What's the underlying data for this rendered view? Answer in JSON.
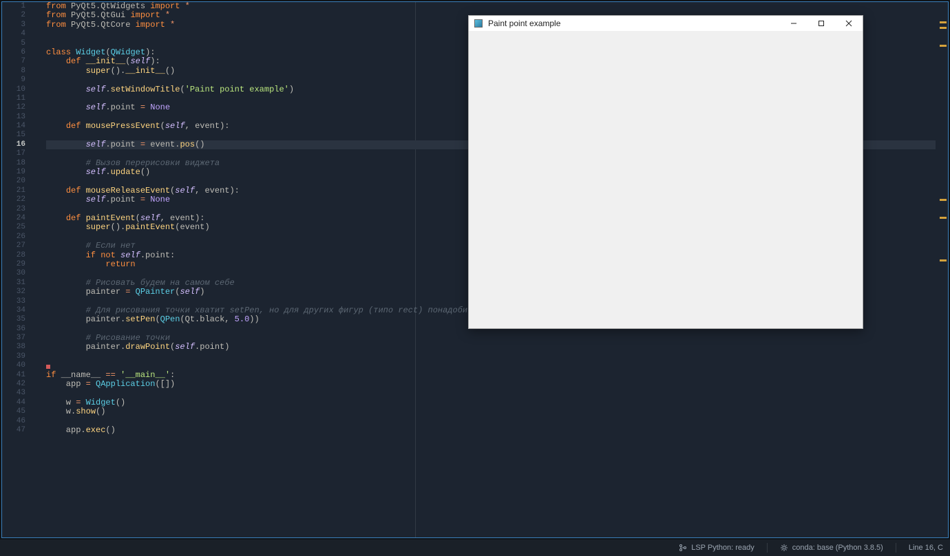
{
  "editor": {
    "currentLine": 16,
    "warnings": [
      1,
      2,
      3,
      6,
      32,
      35,
      42
    ],
    "lines": [
      {
        "n": 1,
        "tokens": [
          [
            "kw",
            "from"
          ],
          [
            "name",
            " PyQt5.QtWidgets "
          ],
          [
            "kw",
            "import"
          ],
          [
            "op",
            " *"
          ]
        ]
      },
      {
        "n": 2,
        "tokens": [
          [
            "kw",
            "from"
          ],
          [
            "name",
            " PyQt5.QtGui "
          ],
          [
            "kw",
            "import"
          ],
          [
            "op",
            " *"
          ]
        ]
      },
      {
        "n": 3,
        "tokens": [
          [
            "kw",
            "from"
          ],
          [
            "name",
            " PyQt5.QtCore "
          ],
          [
            "kw",
            "import"
          ],
          [
            "op",
            " *"
          ]
        ]
      },
      {
        "n": 4,
        "tokens": []
      },
      {
        "n": 5,
        "tokens": []
      },
      {
        "n": 6,
        "tokens": [
          [
            "kw",
            "class"
          ],
          [
            "name",
            " "
          ],
          [
            "cls",
            "Widget"
          ],
          [
            "punct",
            "("
          ],
          [
            "cls",
            "QWidget"
          ],
          [
            "punct",
            "):"
          ]
        ]
      },
      {
        "n": 7,
        "tokens": [
          [
            "name",
            "    "
          ],
          [
            "kw",
            "def"
          ],
          [
            "name",
            " "
          ],
          [
            "fn",
            "__init__"
          ],
          [
            "punct",
            "("
          ],
          [
            "self",
            "self"
          ],
          [
            "punct",
            "):"
          ]
        ]
      },
      {
        "n": 8,
        "tokens": [
          [
            "name",
            "        "
          ],
          [
            "fn",
            "super"
          ],
          [
            "punct",
            "()."
          ],
          [
            "fn",
            "__init__"
          ],
          [
            "punct",
            "()"
          ]
        ]
      },
      {
        "n": 9,
        "tokens": []
      },
      {
        "n": 10,
        "tokens": [
          [
            "name",
            "        "
          ],
          [
            "self",
            "self"
          ],
          [
            "punct",
            "."
          ],
          [
            "fn",
            "setWindowTitle"
          ],
          [
            "punct",
            "("
          ],
          [
            "str",
            "'Paint point example'"
          ],
          [
            "punct",
            ")"
          ]
        ]
      },
      {
        "n": 11,
        "tokens": []
      },
      {
        "n": 12,
        "tokens": [
          [
            "name",
            "        "
          ],
          [
            "self",
            "self"
          ],
          [
            "punct",
            ".point "
          ],
          [
            "op",
            "="
          ],
          [
            "name",
            " "
          ],
          [
            "none",
            "None"
          ]
        ]
      },
      {
        "n": 13,
        "tokens": []
      },
      {
        "n": 14,
        "tokens": [
          [
            "name",
            "    "
          ],
          [
            "kw",
            "def"
          ],
          [
            "name",
            " "
          ],
          [
            "fn",
            "mousePressEvent"
          ],
          [
            "punct",
            "("
          ],
          [
            "self",
            "self"
          ],
          [
            "punct",
            ", event):"
          ]
        ]
      },
      {
        "n": 15,
        "tokens": []
      },
      {
        "n": 16,
        "tokens": [
          [
            "name",
            "        "
          ],
          [
            "self",
            "self"
          ],
          [
            "punct",
            ".point "
          ],
          [
            "op",
            "="
          ],
          [
            "name",
            " event."
          ],
          [
            "fn",
            "pos"
          ],
          [
            "punct",
            "()"
          ]
        ]
      },
      {
        "n": 17,
        "tokens": []
      },
      {
        "n": 18,
        "tokens": [
          [
            "name",
            "        "
          ],
          [
            "cmt",
            "# Вызов перерисовки виджета"
          ]
        ]
      },
      {
        "n": 19,
        "tokens": [
          [
            "name",
            "        "
          ],
          [
            "self",
            "self"
          ],
          [
            "punct",
            "."
          ],
          [
            "fn",
            "update"
          ],
          [
            "punct",
            "()"
          ]
        ]
      },
      {
        "n": 20,
        "tokens": []
      },
      {
        "n": 21,
        "tokens": [
          [
            "name",
            "    "
          ],
          [
            "kw",
            "def"
          ],
          [
            "name",
            " "
          ],
          [
            "fn",
            "mouseReleaseEvent"
          ],
          [
            "punct",
            "("
          ],
          [
            "self",
            "self"
          ],
          [
            "punct",
            ", event):"
          ]
        ]
      },
      {
        "n": 22,
        "tokens": [
          [
            "name",
            "        "
          ],
          [
            "self",
            "self"
          ],
          [
            "punct",
            ".point "
          ],
          [
            "op",
            "="
          ],
          [
            "name",
            " "
          ],
          [
            "none",
            "None"
          ]
        ]
      },
      {
        "n": 23,
        "tokens": []
      },
      {
        "n": 24,
        "tokens": [
          [
            "name",
            "    "
          ],
          [
            "kw",
            "def"
          ],
          [
            "name",
            " "
          ],
          [
            "fn",
            "paintEvent"
          ],
          [
            "punct",
            "("
          ],
          [
            "self",
            "self"
          ],
          [
            "punct",
            ", event):"
          ]
        ]
      },
      {
        "n": 25,
        "tokens": [
          [
            "name",
            "        "
          ],
          [
            "fn",
            "super"
          ],
          [
            "punct",
            "()."
          ],
          [
            "fn",
            "paintEvent"
          ],
          [
            "punct",
            "(event)"
          ]
        ]
      },
      {
        "n": 26,
        "tokens": []
      },
      {
        "n": 27,
        "tokens": [
          [
            "name",
            "        "
          ],
          [
            "cmt",
            "# Если нет"
          ]
        ]
      },
      {
        "n": 28,
        "tokens": [
          [
            "name",
            "        "
          ],
          [
            "kw",
            "if"
          ],
          [
            "name",
            " "
          ],
          [
            "kw",
            "not"
          ],
          [
            "name",
            " "
          ],
          [
            "self",
            "self"
          ],
          [
            "punct",
            ".point:"
          ]
        ]
      },
      {
        "n": 29,
        "tokens": [
          [
            "name",
            "            "
          ],
          [
            "kw",
            "return"
          ]
        ]
      },
      {
        "n": 30,
        "tokens": []
      },
      {
        "n": 31,
        "tokens": [
          [
            "name",
            "        "
          ],
          [
            "cmt",
            "# Рисовать будем на самом себе"
          ]
        ]
      },
      {
        "n": 32,
        "tokens": [
          [
            "name",
            "        painter "
          ],
          [
            "op",
            "="
          ],
          [
            "name",
            " "
          ],
          [
            "cls",
            "QPainter"
          ],
          [
            "punct",
            "("
          ],
          [
            "self",
            "self"
          ],
          [
            "punct",
            ")"
          ]
        ]
      },
      {
        "n": 33,
        "tokens": []
      },
      {
        "n": 34,
        "tokens": [
          [
            "name",
            "        "
          ],
          [
            "cmt",
            "# Для рисования точки хватит setPen, но для других фигур (типо rect) понадобится setBrush"
          ]
        ]
      },
      {
        "n": 35,
        "tokens": [
          [
            "name",
            "        painter."
          ],
          [
            "fn",
            "setPen"
          ],
          [
            "punct",
            "("
          ],
          [
            "cls",
            "QPen"
          ],
          [
            "punct",
            "(Qt.black, "
          ],
          [
            "num",
            "5.0"
          ],
          [
            "punct",
            "))"
          ]
        ]
      },
      {
        "n": 36,
        "tokens": []
      },
      {
        "n": 37,
        "tokens": [
          [
            "name",
            "        "
          ],
          [
            "cmt",
            "# Рисование точки"
          ]
        ]
      },
      {
        "n": 38,
        "tokens": [
          [
            "name",
            "        painter."
          ],
          [
            "fn",
            "drawPoint"
          ],
          [
            "punct",
            "("
          ],
          [
            "self",
            "self"
          ],
          [
            "punct",
            ".point)"
          ]
        ]
      },
      {
        "n": 39,
        "tokens": []
      },
      {
        "n": 40,
        "tokens": []
      },
      {
        "n": 41,
        "tokens": [
          [
            "kw",
            "if"
          ],
          [
            "name",
            " __name__ "
          ],
          [
            "op",
            "=="
          ],
          [
            "name",
            " "
          ],
          [
            "str",
            "'__main__'"
          ],
          [
            "punct",
            ":"
          ]
        ]
      },
      {
        "n": 42,
        "tokens": [
          [
            "name",
            "    app "
          ],
          [
            "op",
            "="
          ],
          [
            "name",
            " "
          ],
          [
            "cls",
            "QApplication"
          ],
          [
            "punct",
            "([])"
          ]
        ]
      },
      {
        "n": 43,
        "tokens": []
      },
      {
        "n": 44,
        "tokens": [
          [
            "name",
            "    w "
          ],
          [
            "op",
            "="
          ],
          [
            "name",
            " "
          ],
          [
            "cls",
            "Widget"
          ],
          [
            "punct",
            "()"
          ]
        ]
      },
      {
        "n": 45,
        "tokens": [
          [
            "name",
            "    w."
          ],
          [
            "fn",
            "show"
          ],
          [
            "punct",
            "()"
          ]
        ]
      },
      {
        "n": 46,
        "tokens": []
      },
      {
        "n": 47,
        "tokens": [
          [
            "name",
            "    app."
          ],
          [
            "fn",
            "exec"
          ],
          [
            "punct",
            "()"
          ]
        ]
      }
    ],
    "minimapMarks": [
      28,
      36,
      62,
      286,
      312,
      374
    ]
  },
  "appWindow": {
    "title": "Paint point example"
  },
  "statusbar": {
    "lsp": "LSP Python: ready",
    "conda": "conda: base (Python 3.8.5)",
    "pos": "Line 16, C"
  }
}
